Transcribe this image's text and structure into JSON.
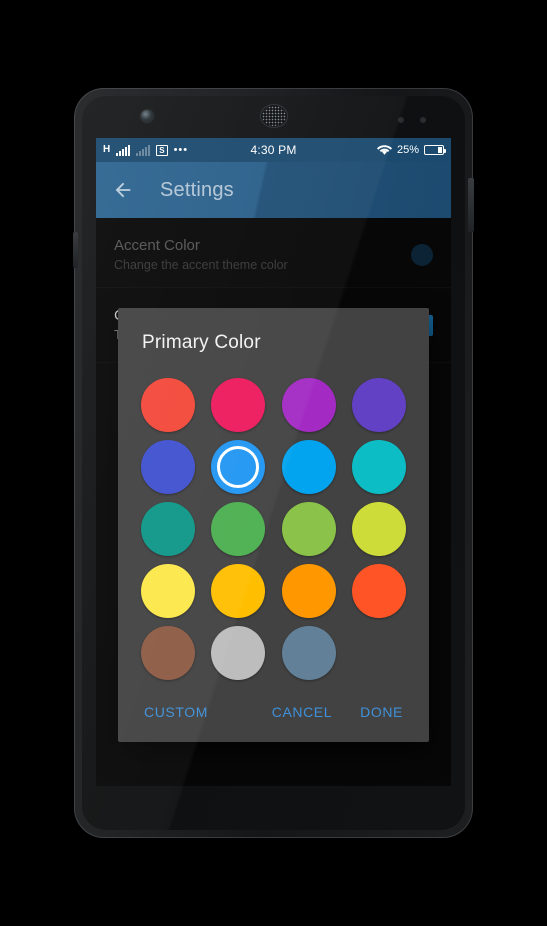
{
  "device": {
    "camera_icon": "front-camera",
    "speaker_icon": "earpiece-speaker",
    "sensor_icon": "proximity-sensor"
  },
  "status_bar": {
    "network_type": "H",
    "sim_label": "S",
    "more_icon": "overflow-dots-icon",
    "signal_icon": "signal-bars-icon",
    "signal_icon_secondary": "signal-bars-dim-icon",
    "time": "4:30 PM",
    "wifi_icon": "wifi-icon",
    "battery_percent": "25%",
    "battery_level": 25,
    "battery_icon": "battery-icon",
    "background_color": "#1b4a6e"
  },
  "app_bar": {
    "back_icon": "back-arrow-icon",
    "title": "Settings",
    "background_color": "#2a5f8a"
  },
  "settings": {
    "rows": [
      {
        "title": "Accent Color",
        "subtitle": "Change the accent theme color",
        "dot_color": "#1f5d8c",
        "control": "color-dot"
      },
      {
        "title": "Colored Status Bar",
        "subtitle": "Toggle status bar coloring",
        "checked": true,
        "control": "checkbox",
        "checkbox_color": "#14669b"
      }
    ]
  },
  "dialog": {
    "title": "Primary Color",
    "background_color": "#424242",
    "selected_index": 5,
    "selection_ring_color": "#ffffff",
    "swatches": [
      {
        "name": "red",
        "hex": "#F4483A"
      },
      {
        "name": "pink",
        "hex": "#EC1A5E"
      },
      {
        "name": "purple",
        "hex": "#A32BC4"
      },
      {
        "name": "deep-purple",
        "hex": "#6241C4"
      },
      {
        "name": "indigo",
        "hex": "#3F51CF"
      },
      {
        "name": "blue",
        "hex": "#2196F3"
      },
      {
        "name": "light-blue",
        "hex": "#03A4EF"
      },
      {
        "name": "cyan",
        "hex": "#0CBDC5"
      },
      {
        "name": "teal",
        "hex": "#0E9688"
      },
      {
        "name": "green",
        "hex": "#4CAF50"
      },
      {
        "name": "light-green",
        "hex": "#8BC34A"
      },
      {
        "name": "lime",
        "hex": "#CDDC39"
      },
      {
        "name": "yellow",
        "hex": "#FCE749"
      },
      {
        "name": "amber",
        "hex": "#FFBF00"
      },
      {
        "name": "orange",
        "hex": "#FF9800"
      },
      {
        "name": "deep-orange",
        "hex": "#FF5526"
      },
      {
        "name": "brown",
        "hex": "#8D5B45"
      },
      {
        "name": "grey",
        "hex": "#BDBDBD"
      },
      {
        "name": "blue-grey",
        "hex": "#628198"
      },
      {
        "name": "empty",
        "hex": ""
      }
    ],
    "buttons": {
      "custom": "CUSTOM",
      "cancel": "CANCEL",
      "done": "DONE",
      "color": "#3f90d8"
    }
  }
}
